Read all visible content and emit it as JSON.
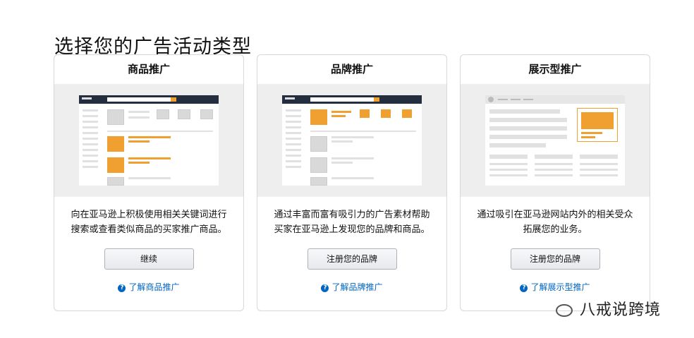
{
  "header": {
    "title": "选择您的广告活动类型"
  },
  "cards": [
    {
      "title": "商品推广",
      "description_line1": "向在亚马逊上积极使用相关关键词进行",
      "description_line2": "搜索或查看类似商品的买家推广商品。",
      "button_label": "继续",
      "learn_more_label": "了解商品推广"
    },
    {
      "title": "品牌推广",
      "description_line1": "通过丰富而富有吸引力的广告素材帮助",
      "description_line2": "买家在亚马逊上发现您的品牌和商品。",
      "button_label": "注册您的品牌",
      "learn_more_label": "了解品牌推广"
    },
    {
      "title": "展示型推广",
      "description_line1": "通过吸引在亚马逊网站内外的相关受众",
      "description_line2": "拓展您的业务。",
      "button_label": "注册您的品牌",
      "learn_more_label": "了解展示型推广"
    }
  ],
  "watermark": {
    "text": "八戒说跨境"
  },
  "colors": {
    "accent": "#f0a030",
    "link": "#0066c0",
    "preview_bg": "#eeeeee"
  },
  "icons": {
    "help": "question-circle-icon",
    "watermark": "wechat-icon"
  }
}
